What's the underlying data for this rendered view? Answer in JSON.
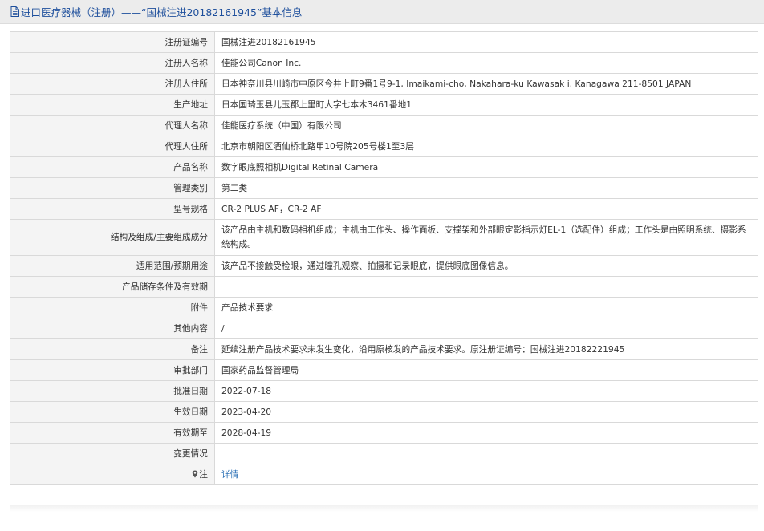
{
  "header": {
    "title": "进口医疗器械（注册）——“国械注进20182161945”基本信息",
    "icon": "document-icon"
  },
  "rows": [
    {
      "label": "注册证编号",
      "value": "国械注进20182161945"
    },
    {
      "label": "注册人名称",
      "value": "佳能公司Canon Inc."
    },
    {
      "label": "注册人住所",
      "value": "日本神奈川县川崎市中原区今井上町9番1号9-1, Imaikami-cho, Nakahara-ku Kawasak i, Kanagawa 211-8501 JAPAN"
    },
    {
      "label": "生产地址",
      "value": "日本国琦玉县儿玉郡上里町大字七本木3461番地1"
    },
    {
      "label": "代理人名称",
      "value": "佳能医疗系统（中国）有限公司"
    },
    {
      "label": "代理人住所",
      "value": "北京市朝阳区酒仙桥北路甲10号院205号楼1至3层"
    },
    {
      "label": "产品名称",
      "value": "数字眼底照相机Digital Retinal Camera"
    },
    {
      "label": "管理类别",
      "value": "第二类"
    },
    {
      "label": "型号规格",
      "value": "CR-2 PLUS AF，CR-2 AF"
    },
    {
      "label": "结构及组成/主要组成成分",
      "value": "该产品由主机和数码相机组成；主机由工作头、操作面板、支撑架和外部眼定影指示灯EL-1（选配件）组成；工作头是由照明系统、摄影系统构成。"
    },
    {
      "label": "适用范围/预期用途",
      "value": "该产品不接触受检眼，通过瞳孔观察、拍摄和记录眼底，提供眼底图像信息。"
    },
    {
      "label": "产品储存条件及有效期",
      "value": ""
    },
    {
      "label": "附件",
      "value": "产品技术要求"
    },
    {
      "label": "其他内容",
      "value": "/"
    },
    {
      "label": "备注",
      "value": "延续注册产品技术要求未发生变化，沿用原核发的产品技术要求。原注册证编号：国械注进20182221945"
    },
    {
      "label": "审批部门",
      "value": "国家药品监督管理局"
    },
    {
      "label": "批准日期",
      "value": "2022-07-18"
    },
    {
      "label": "生效日期",
      "value": "2023-04-20"
    },
    {
      "label": "有效期至",
      "value": "2028-04-19"
    },
    {
      "label": "变更情况",
      "value": ""
    },
    {
      "label": "注",
      "value": "详情",
      "icon": "location-pin-icon"
    }
  ],
  "colors": {
    "accent": "#1e4f9c",
    "link": "#2a6fb5",
    "label_bg": "#f4f4f4",
    "border": "#d9d9d9"
  }
}
